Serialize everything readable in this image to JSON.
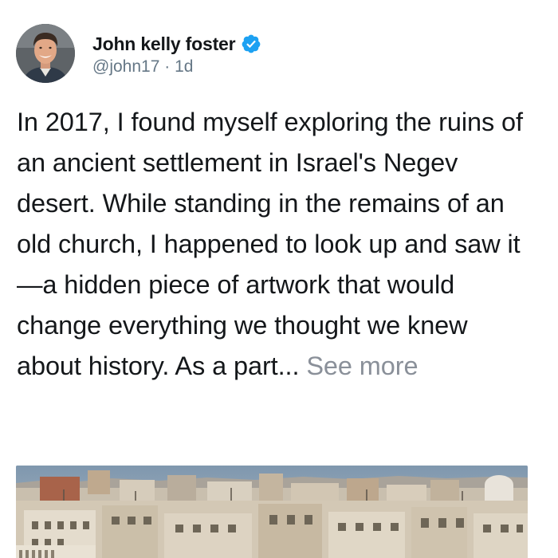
{
  "post": {
    "author": {
      "display_name": "John kelly foster",
      "handle": "@john17",
      "separator": "·",
      "time_ago": "1d",
      "verified_icon": "verified-badge-icon",
      "verified_color": "#1da1f2"
    },
    "text": "In 2017, I found myself exploring the ruins of an ancient settlement in Israel's Negev desert. While standing in the remains of an old church, I happened to look up and saw it—a hidden piece of artwork that would change everything we thought we knew about history. As a part...",
    "see_more_label": "See more",
    "media": {
      "icon": "city-rooftops-photo"
    }
  },
  "colors": {
    "text": "#14171a",
    "muted": "#657786",
    "see_more": "#8a9099",
    "accent": "#1da1f2"
  }
}
